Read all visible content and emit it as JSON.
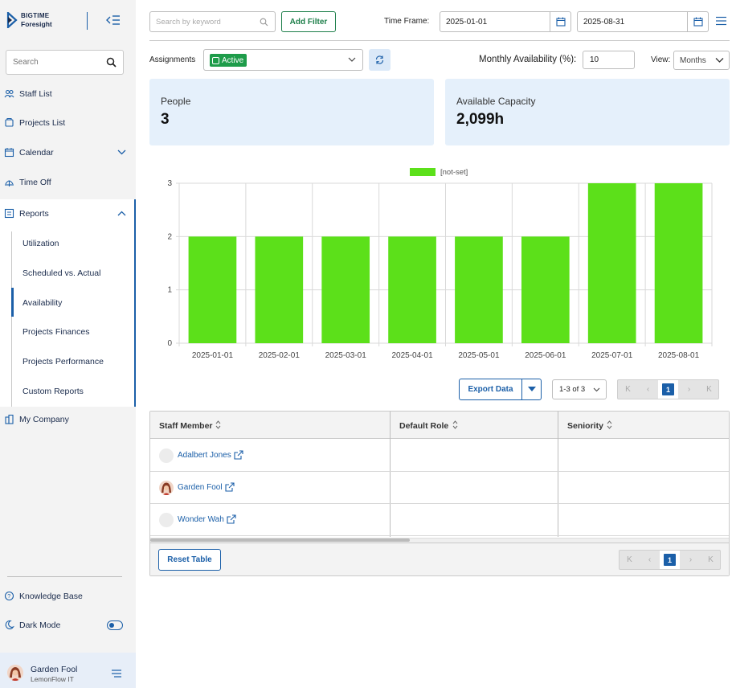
{
  "brand": {
    "line1": "BIGTIME",
    "line2": "Foresight"
  },
  "sidebar": {
    "search_placeholder": "Search",
    "items": [
      {
        "label": "Staff List",
        "icon": "users-icon"
      },
      {
        "label": "Projects List",
        "icon": "folder-icon"
      },
      {
        "label": "Calendar",
        "icon": "calendar-icon"
      },
      {
        "label": "Time Off",
        "icon": "time-off-icon"
      },
      {
        "label": "Reports",
        "icon": "reports-icon"
      },
      {
        "label": "My Company",
        "icon": "company-icon"
      }
    ],
    "reports_sub": [
      {
        "label": "Utilization"
      },
      {
        "label": "Scheduled vs. Actual"
      },
      {
        "label": "Availability"
      },
      {
        "label": "Projects Finances"
      },
      {
        "label": "Projects Performance"
      },
      {
        "label": "Custom Reports"
      }
    ],
    "active_sub": "Availability",
    "bottom": [
      {
        "label": "Knowledge Base",
        "icon": "help-icon"
      },
      {
        "label": "Dark Mode",
        "icon": "moon-icon"
      }
    ],
    "dark_mode_on": true,
    "user": {
      "name": "Garden Fool",
      "org": "LemonFlow IT"
    }
  },
  "toolbar": {
    "keyword_placeholder": "Search by keyword",
    "add_filter": "Add Filter",
    "time_frame_label": "Time Frame:",
    "start_date": "2025-01-01",
    "end_date": "2025-08-31",
    "assignments_label": "Assignments",
    "assignments_tag": "Active",
    "monthly_availability_label": "Monthly Availability (%):",
    "monthly_availability_value": "10",
    "view_label": "View:",
    "view_value": "Months"
  },
  "stats": {
    "people": {
      "title": "People",
      "value": "3"
    },
    "capacity": {
      "title": "Available Capacity",
      "value": "2,099h"
    }
  },
  "chart_data": {
    "type": "bar",
    "categories": [
      "2025-01-01",
      "2025-02-01",
      "2025-03-01",
      "2025-04-01",
      "2025-05-01",
      "2025-06-01",
      "2025-07-01",
      "2025-08-01"
    ],
    "series": [
      {
        "name": "[not-set]",
        "values": [
          2,
          2,
          2,
          2,
          2,
          2,
          3,
          3
        ],
        "color": "#5ce01a"
      }
    ],
    "ylim": [
      0,
      3
    ],
    "yticks": [
      0,
      1,
      2,
      3
    ],
    "grid": true,
    "legend": "top-center"
  },
  "table_controls": {
    "export_label": "Export Data",
    "range_label": "1-3 of 3",
    "page": "1"
  },
  "table": {
    "columns": [
      "Staff Member",
      "Default Role",
      "Seniority"
    ],
    "rows": [
      {
        "name": "Adalbert Jones",
        "role": "",
        "seniority": ""
      },
      {
        "name": "Garden Fool",
        "role": "",
        "seniority": ""
      },
      {
        "name": "Wonder Wah",
        "role": "",
        "seniority": ""
      }
    ],
    "reset_label": "Reset Table"
  },
  "colors": {
    "accent": "#1b5fa8",
    "green": "#1e9c4a",
    "bar": "#5ce01a",
    "card": "#e5f0fb"
  }
}
